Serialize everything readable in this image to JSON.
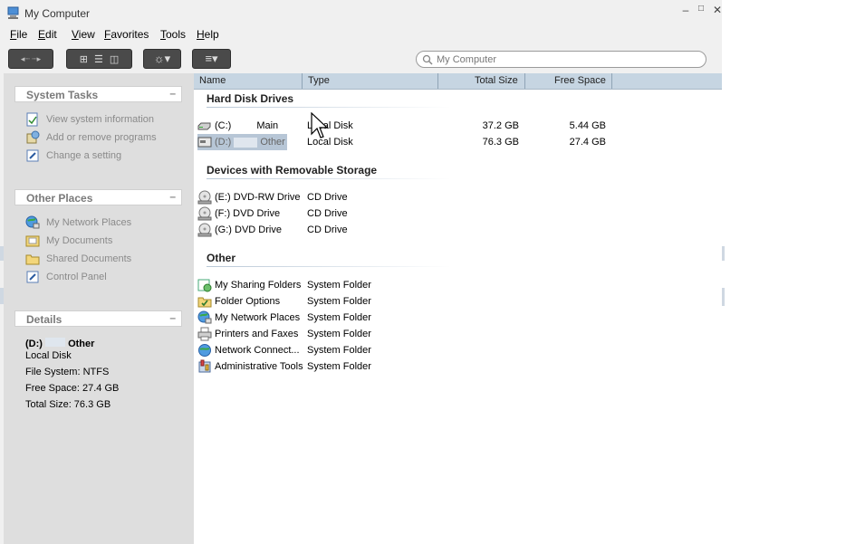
{
  "window": {
    "title": "My Computer",
    "controls": {
      "minimize": "–",
      "maximize": "□",
      "close": "✕"
    }
  },
  "menu": {
    "items": [
      {
        "accel": "F",
        "rest": "ile"
      },
      {
        "accel": "E",
        "rest": "dit"
      },
      {
        "accel": "V",
        "rest": "iew"
      },
      {
        "accel": "F",
        "pre": "",
        "label_pre": "",
        "rest": "avorites"
      },
      {
        "accel": "T",
        "rest": "ools"
      },
      {
        "accel": "H",
        "rest": "elp"
      }
    ]
  },
  "toolbar": {
    "back_forward": "◂┈ ┈▸",
    "view_thumbs": "⊞",
    "view_list": "☰",
    "view_details": "◫",
    "organize": "☼▾",
    "menu": "≡▾"
  },
  "search": {
    "placeholder": "My Computer"
  },
  "sidebar": {
    "system_tasks": {
      "title": "System Tasks",
      "collapse": "–",
      "items": [
        "View system information",
        "Add or remove programs",
        "Change a setting"
      ]
    },
    "other_places": {
      "title": "Other Places",
      "collapse": "–",
      "items": [
        "My Network Places",
        "My Documents",
        "Shared Documents",
        "Control Panel"
      ]
    },
    "details": {
      "title": "Details",
      "collapse": "–",
      "name_prefix": "(D:)",
      "name_suffix": "Other",
      "type": "Local Disk",
      "file_system": "File System: NTFS",
      "free_space": "Free Space: 27.4 GB",
      "total_size": "Total Size: 76.3 GB"
    }
  },
  "columns": {
    "name": "Name",
    "type": "Type",
    "total_size": "Total Size",
    "free_space": "Free Space"
  },
  "groups": {
    "hard_disks": {
      "title": "Hard Disk Drives",
      "rows": [
        {
          "drive": "(C:)",
          "label": "Main",
          "type": "Local Disk",
          "total": "37.2 GB",
          "free": "5.44 GB"
        },
        {
          "drive": "(D:)",
          "label": "Other",
          "type": "Local Disk",
          "total": "76.3 GB",
          "free": "27.4 GB"
        }
      ]
    },
    "removable": {
      "title": "Devices with Removable Storage",
      "rows": [
        {
          "name": "(E:) DVD-RW Drive",
          "type": "CD Drive"
        },
        {
          "name": "(F:) DVD Drive",
          "type": "CD Drive"
        },
        {
          "name": "(G:) DVD Drive",
          "type": "CD Drive"
        }
      ]
    },
    "other": {
      "title": "Other",
      "rows": [
        {
          "name": "My Sharing Folders",
          "type": "System Folder"
        },
        {
          "name": "Folder Options",
          "type": "System Folder"
        },
        {
          "name": "My Network Places",
          "type": "System Folder"
        },
        {
          "name": "Printers and Faxes",
          "type": "System Folder"
        },
        {
          "name": "Network Connect...",
          "type": "System Folder"
        },
        {
          "name": "Administrative Tools",
          "type": "System Folder"
        }
      ]
    }
  }
}
